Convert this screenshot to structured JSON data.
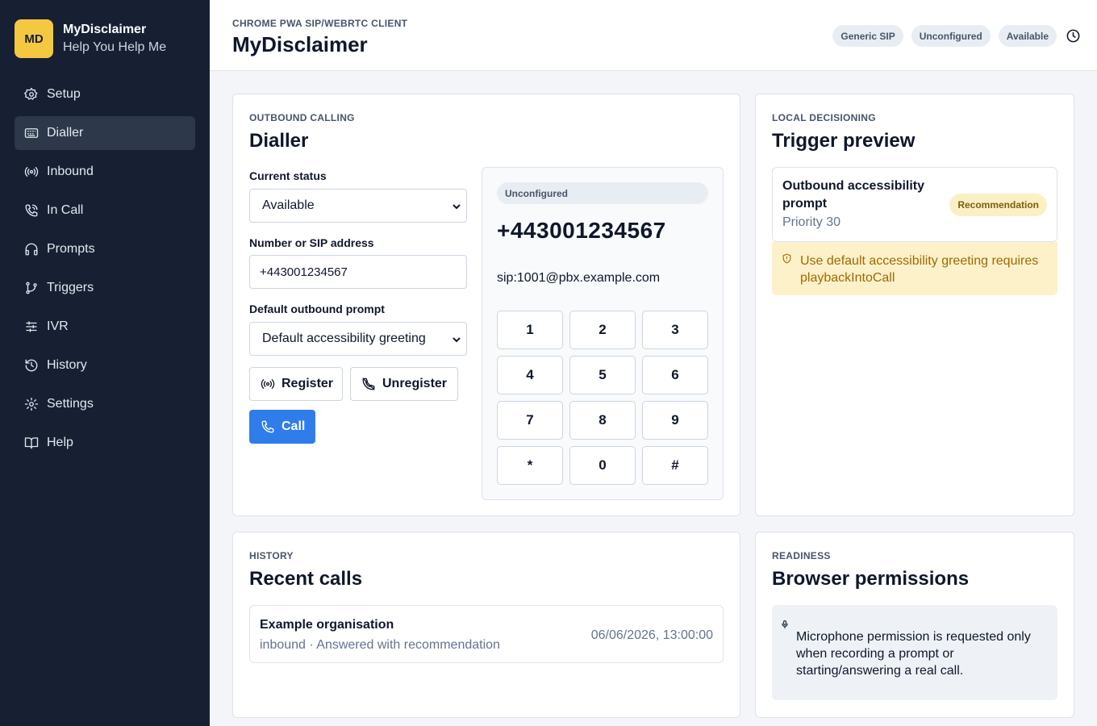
{
  "brand": {
    "logo": "MD",
    "name": "MyDisclaimer",
    "tagline": "Help You Help Me"
  },
  "sidebar": {
    "items": [
      {
        "label": "Setup",
        "icon": "gear-icon"
      },
      {
        "label": "Dialler",
        "icon": "keyboard-icon",
        "active": true
      },
      {
        "label": "Inbound",
        "icon": "broadcast-icon"
      },
      {
        "label": "In Call",
        "icon": "phone-call-icon"
      },
      {
        "label": "Prompts",
        "icon": "headphones-icon"
      },
      {
        "label": "Triggers",
        "icon": "branch-icon"
      },
      {
        "label": "IVR",
        "icon": "sliders-icon"
      },
      {
        "label": "History",
        "icon": "history-icon"
      },
      {
        "label": "Settings",
        "icon": "settings-icon"
      },
      {
        "label": "Help",
        "icon": "book-icon"
      }
    ]
  },
  "header": {
    "eyebrow": "CHROME PWA SIP/WEBRTC CLIENT",
    "title": "MyDisclaimer",
    "badges": [
      "Generic SIP",
      "Unconfigured",
      "Available"
    ]
  },
  "dialler": {
    "eyebrow": "OUTBOUND CALLING",
    "title": "Dialler",
    "status_label": "Current status",
    "status_value": "Available",
    "number_label": "Number or SIP address",
    "number_value": "+443001234567",
    "prompt_label": "Default outbound prompt",
    "prompt_value": "Default accessibility greeting",
    "register_label": "Register",
    "unregister_label": "Unregister",
    "call_label": "Call",
    "panel": {
      "status": "Unconfigured",
      "number": "+443001234567",
      "sip_uri": "sip:1001@pbx.example.com"
    },
    "keys": [
      "1",
      "2",
      "3",
      "4",
      "5",
      "6",
      "7",
      "8",
      "9",
      "*",
      "0",
      "#"
    ]
  },
  "trigger": {
    "eyebrow": "LOCAL DECISIONING",
    "title": "Trigger preview",
    "name": "Outbound accessibility prompt",
    "priority": "Priority 30",
    "badge": "Recommendation",
    "warning": "Use default accessibility greeting requires playbackIntoCall"
  },
  "history": {
    "eyebrow": "HISTORY",
    "title": "Recent calls",
    "rows": [
      {
        "name": "Example organisation",
        "detail": "inbound · Answered with recommendation",
        "time": "06/06/2026, 13:00:00"
      }
    ]
  },
  "readiness": {
    "eyebrow": "READINESS",
    "title": "Browser permissions",
    "message": "Microphone permission is requested only when recording a prompt or starting/answering a real call."
  },
  "colors": {
    "sidebar": "#172033",
    "accent": "#2f7dea",
    "brand": "#f5c842",
    "warning_bg": "#fdf1c9",
    "warning_text": "#9a6b05"
  }
}
